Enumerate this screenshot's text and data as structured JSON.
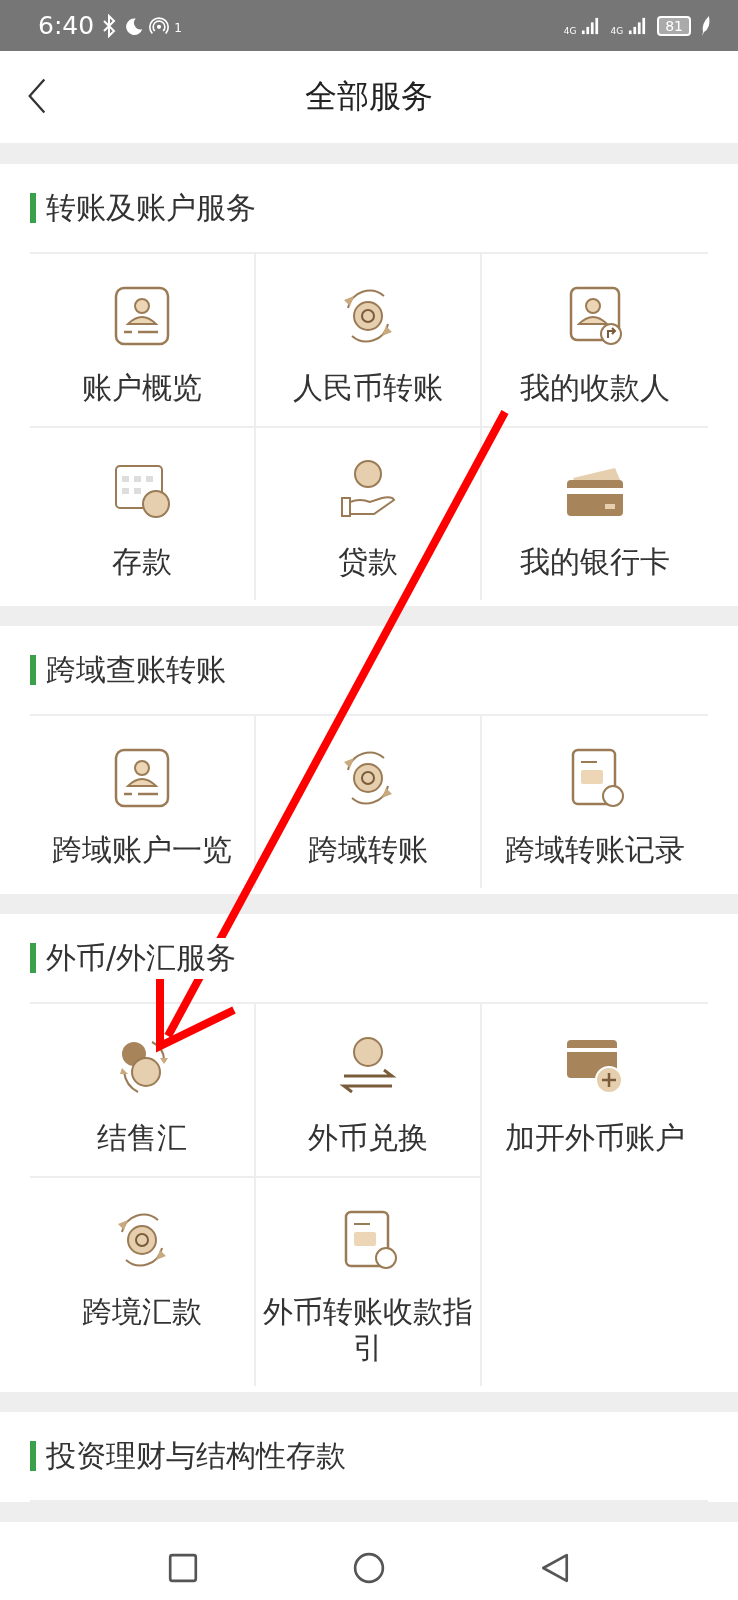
{
  "status_bar": {
    "time": "6:40",
    "hotspot_count": "1",
    "networks": [
      "4G",
      "4G"
    ],
    "battery": "81"
  },
  "header": {
    "title": "全部服务"
  },
  "sections": [
    {
      "title": "转账及账户服务",
      "items": [
        "账户概览",
        "人民币转账",
        "我的收款人",
        "存款",
        "贷款",
        "我的银行卡"
      ]
    },
    {
      "title": "跨域查账转账",
      "items": [
        "跨域账户一览",
        "跨域转账",
        "跨域转账记录"
      ]
    },
    {
      "title": "外币/外汇服务",
      "items": [
        "结售汇",
        "外币兑换",
        "加开外币账户",
        "跨境汇款",
        "外币转账收款指引"
      ]
    },
    {
      "title": "投资理财与结构性存款"
    }
  ],
  "annotation": {
    "kind": "arrow"
  }
}
